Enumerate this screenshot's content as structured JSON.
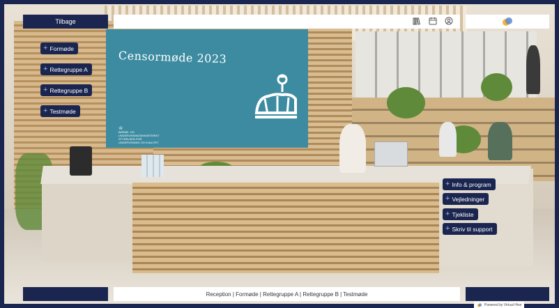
{
  "top": {
    "back_label": "Tilbage"
  },
  "toolbar": {
    "icons": [
      "library-icon",
      "calendar-icon",
      "account-icon"
    ]
  },
  "brand_logo": "virtual-hive-logo",
  "screen": {
    "title": "Censormøde 2023",
    "ministry_lines": [
      "Børne- og",
      "Undervisningsministeriet",
      "Styrelsen for",
      "Undervisning og Kvalitet"
    ]
  },
  "left_menu": [
    {
      "label": "Formøde"
    },
    {
      "label": "Rettegruppe A"
    },
    {
      "label": "Rettegruppe B"
    },
    {
      "label": "Testmøde"
    }
  ],
  "right_menu": [
    {
      "label": "Info & program"
    },
    {
      "label": "Vejledninger"
    },
    {
      "label": "Tjekliste"
    },
    {
      "label": "Skriv til support"
    }
  ],
  "breadcrumb": "Reception | Formøde | Rettegruppe A | Rettegruppe B | Testmøde",
  "footer": {
    "powered_by": "Powered by Virtual Hive"
  },
  "colors": {
    "navy": "#1b2650",
    "screen_teal": "#3d8ba1",
    "plus": "#9fb4e6"
  }
}
